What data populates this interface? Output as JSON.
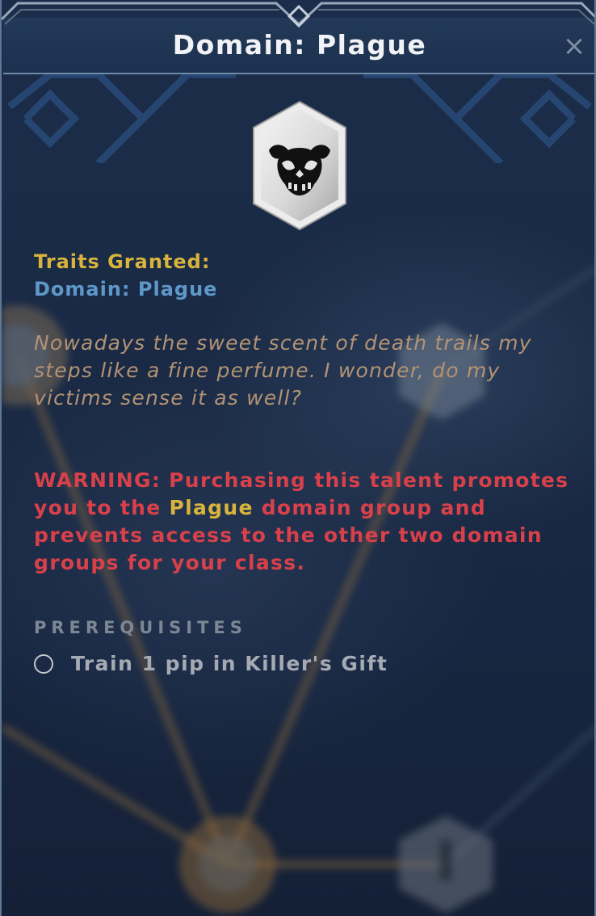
{
  "dialog": {
    "title": "Domain: Plague",
    "close_icon": "close-icon",
    "emblem_icon": "plague-skull-icon"
  },
  "traits": {
    "label": "Traits Granted:",
    "value": "Domain: Plague"
  },
  "flavor_text": "Nowadays the sweet scent of death trails my steps like a fine perfume. I wonder, do my victims sense it as well?",
  "warning": {
    "prefix": "WARNING: Purchasing this talent promotes you to the ",
    "highlight": "Plague",
    "suffix": " domain group and prevents access to the other two domain groups for your class."
  },
  "prerequisites": {
    "title": "PREREQUISITES",
    "items": [
      {
        "text": "Train 1 pip in Killer's Gift",
        "completed": false
      }
    ]
  },
  "colors": {
    "gold": "#d9b43c",
    "trait_blue": "#5f98c8",
    "flavor": "#b39373",
    "warning_red": "#d8404a",
    "panel_bg": "#1b2d4a"
  }
}
